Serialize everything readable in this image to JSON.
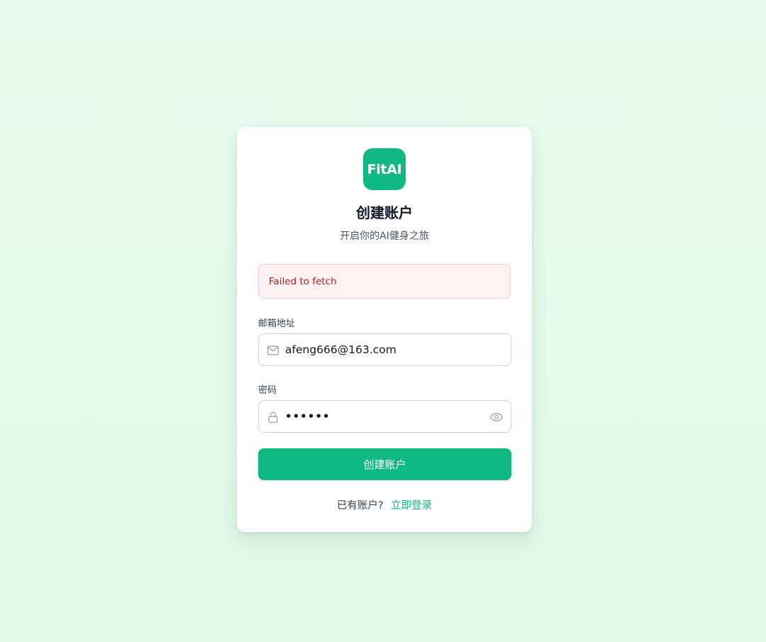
{
  "brand": {
    "logo_text": "FitAI",
    "accent_color": "#10b981"
  },
  "header": {
    "title": "创建账户",
    "subtitle": "开启你的AI健身之旅"
  },
  "error": {
    "message": "Failed to fetch"
  },
  "form": {
    "email": {
      "label": "邮箱地址",
      "value": "afeng666@163.com",
      "icon": "mail-icon"
    },
    "password": {
      "label": "密码",
      "value_masked": "••••••",
      "icon": "lock-icon",
      "toggle_icon": "eye-icon"
    },
    "submit_label": "创建账户"
  },
  "footer": {
    "prompt": "已有账户?",
    "link_label": "立即登录"
  }
}
